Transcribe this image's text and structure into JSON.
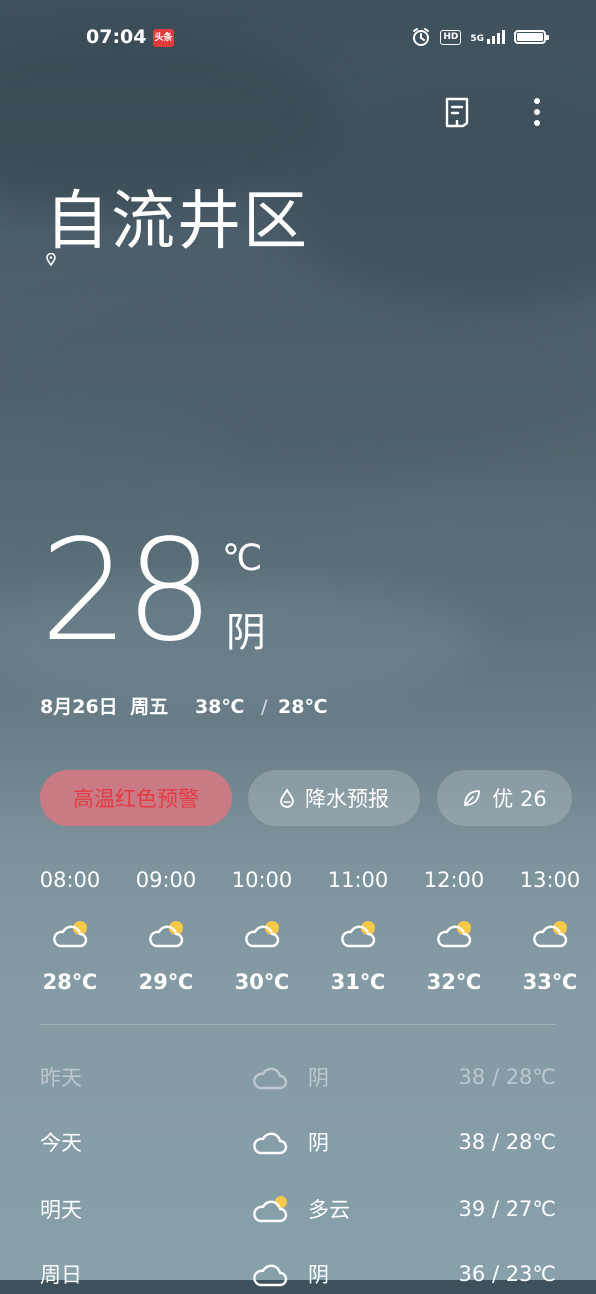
{
  "status": {
    "time": "07:04",
    "news_badge": "头条",
    "hd": "HD",
    "network": "5G"
  },
  "location": {
    "city": "自流井区"
  },
  "current": {
    "temp": "28",
    "unit": "℃",
    "condition": "阴"
  },
  "date_line": {
    "date": "8月26日",
    "weekday": "周五",
    "high": "38℃",
    "sep": "/",
    "low": "28℃"
  },
  "pills": {
    "alert": "高温红色预警",
    "rain": "降水预报",
    "aqi": "优 26"
  },
  "hourly": [
    {
      "time": "08:00",
      "temp": "28℃",
      "icon": "partly-cloudy-icon"
    },
    {
      "time": "09:00",
      "temp": "29℃",
      "icon": "partly-cloudy-icon"
    },
    {
      "time": "10:00",
      "temp": "30℃",
      "icon": "partly-cloudy-icon"
    },
    {
      "time": "11:00",
      "temp": "31℃",
      "icon": "partly-cloudy-icon"
    },
    {
      "time": "12:00",
      "temp": "32℃",
      "icon": "partly-cloudy-icon"
    },
    {
      "time": "13:00",
      "temp": "33℃",
      "icon": "partly-cloudy-icon"
    }
  ],
  "daily": [
    {
      "day": "昨天",
      "condition": "阴",
      "range": "38 / 28℃",
      "icon": "cloud-icon"
    },
    {
      "day": "今天",
      "condition": "阴",
      "range": "38 / 28℃",
      "icon": "cloud-icon"
    },
    {
      "day": "明天",
      "condition": "多云",
      "range": "39 / 27℃",
      "icon": "partly-cloudy-icon"
    },
    {
      "day": "周日",
      "condition": "阴",
      "range": "36 / 23℃",
      "icon": "cloud-icon"
    }
  ],
  "colors": {
    "sun": "#f7c948",
    "alert_text": "#e43b43",
    "alert_bg": "#c97a84"
  }
}
